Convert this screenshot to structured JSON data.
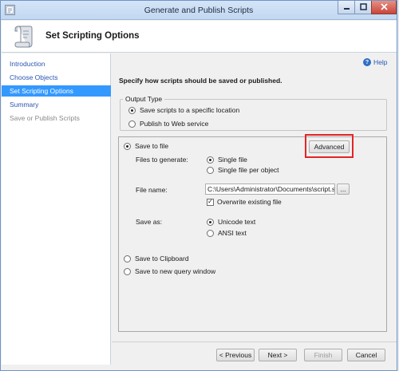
{
  "window": {
    "title": "Generate and Publish Scripts",
    "min_icon": "minimize-icon",
    "max_icon": "maximize-icon",
    "close_icon": "close-icon"
  },
  "header": {
    "title": "Set Scripting Options",
    "icon": "scroll-icon"
  },
  "sidebar": {
    "items": [
      {
        "label": "Introduction",
        "state": "link"
      },
      {
        "label": "Choose Objects",
        "state": "link"
      },
      {
        "label": "Set Scripting Options",
        "state": "active"
      },
      {
        "label": "Summary",
        "state": "link"
      },
      {
        "label": "Save or Publish Scripts",
        "state": "disabled"
      }
    ]
  },
  "help": {
    "label": "Help",
    "icon": "help-icon"
  },
  "main": {
    "intro": "Specify how scripts should be saved or published.",
    "output_type": {
      "legend": "Output Type",
      "options": [
        {
          "label": "Save scripts to a specific location",
          "checked": true
        },
        {
          "label": "Publish to Web service",
          "checked": false
        }
      ]
    },
    "save_to_file": {
      "label": "Save to file",
      "checked": true,
      "advanced_label": "Advanced",
      "files_to_generate_label": "Files to generate:",
      "files_options": [
        {
          "label": "Single file",
          "checked": true
        },
        {
          "label": "Single file per object",
          "checked": false
        }
      ],
      "file_name_label": "File name:",
      "file_name_value": "C:\\Users\\Administrator\\Documents\\script.sql",
      "browse_label": "...",
      "overwrite_label": "Overwrite existing file",
      "overwrite_checked": true,
      "save_as_label": "Save as:",
      "save_as_options": [
        {
          "label": "Unicode text",
          "checked": true
        },
        {
          "label": "ANSI text",
          "checked": false
        }
      ]
    },
    "save_to_clipboard": {
      "label": "Save to Clipboard",
      "checked": false
    },
    "save_to_query_window": {
      "label": "Save to new query window",
      "checked": false
    }
  },
  "footer": {
    "previous_label": "< Previous",
    "next_label": "Next >",
    "finish_label": "Finish",
    "cancel_label": "Cancel"
  },
  "colors": {
    "selection": "#3399ff",
    "link": "#2b56b4",
    "highlight": "#e52424",
    "titlebar": "#c2d8f1"
  }
}
